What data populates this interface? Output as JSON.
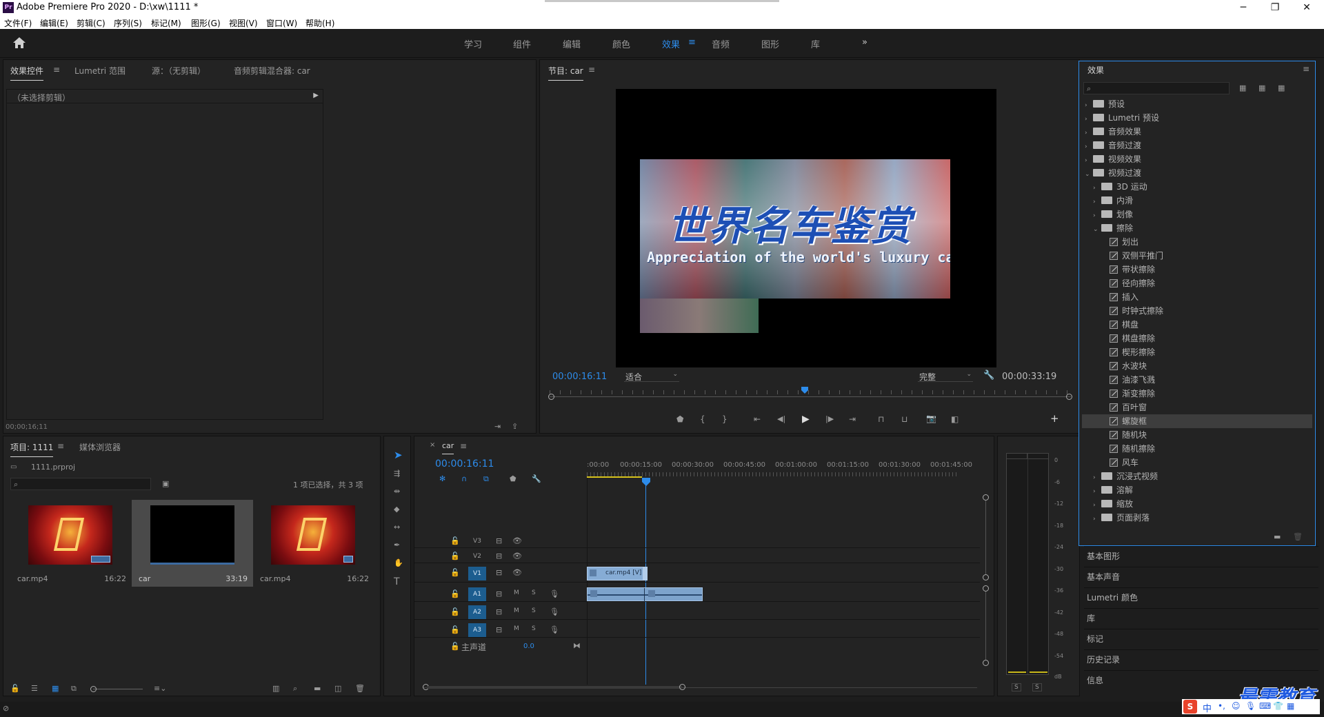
{
  "app": {
    "title": "Adobe Premiere Pro 2020 - D:\\xw\\1111 *",
    "logo": "Pr",
    "menu": [
      "文件(F)",
      "编辑(E)",
      "剪辑(C)",
      "序列(S)",
      "标记(M)",
      "图形(G)",
      "视图(V)",
      "窗口(W)",
      "帮助(H)"
    ]
  },
  "workspaces": {
    "items": [
      "学习",
      "组件",
      "编辑",
      "颜色",
      "效果",
      "音频",
      "图形",
      "库"
    ],
    "active": "效果",
    "active_menu": "≡",
    "more": "»"
  },
  "source_panel": {
    "tabs": [
      "效果控件",
      "Lumetri 范围",
      "源：（无剪辑）",
      "音频剪辑混合器: car"
    ],
    "active_tab_menu": "≡",
    "no_clip": "（未选择剪辑）",
    "timecode": "00;00;16;11"
  },
  "program": {
    "tab": "节目: car",
    "menu": "≡",
    "title_text": "世界名车鉴赏",
    "subtitle_text": "Appreciation of the world's luxury ca",
    "timecode": "00:00:16:11",
    "fit": "适合",
    "quality": "完整",
    "duration": "00:00:33:19",
    "playhead_fraction": 0.49
  },
  "project": {
    "tabs": [
      "项目: 1111",
      "媒体浏览器"
    ],
    "menu": "≡",
    "file": "1111.prproj",
    "selection": "1 项已选择，共 3 项",
    "items": [
      {
        "name": "car.mp4",
        "duration": "16:22"
      },
      {
        "name": "car",
        "duration": "33:19"
      },
      {
        "name": "car.mp4",
        "duration": "16:22"
      }
    ]
  },
  "timeline": {
    "close": "×",
    "sequence": "car",
    "menu": "≡",
    "timecode": "00:00:16:11",
    "ruler": [
      ":00:00",
      "00:00:15:00",
      "00:00:30:00",
      "00:00:45:00",
      "00:01:00:00",
      "00:01:15:00",
      "00:01:30:00",
      "00:01:45:00"
    ],
    "video_tracks": [
      "V3",
      "V2",
      "V1"
    ],
    "audio_tracks": [
      "A1",
      "A2",
      "A3"
    ],
    "master": "主声道",
    "master_value": "0.0",
    "clip_v1": "car.mp4 [V]",
    "m": "M",
    "s": "S"
  },
  "meter": {
    "ticks": [
      "0",
      "-6",
      "-12",
      "-18",
      "-24",
      "-30",
      "-36",
      "-42",
      "-48",
      "-54",
      "dB"
    ],
    "solo_left": "S",
    "solo_right": "S"
  },
  "effects": {
    "title": "效果",
    "menu": "≡",
    "tree": [
      {
        "label": "预设",
        "level": 0,
        "type": "folder",
        "open": false
      },
      {
        "label": "Lumetri 预设",
        "level": 0,
        "type": "folder",
        "open": false
      },
      {
        "label": "音频效果",
        "level": 0,
        "type": "folder",
        "open": false
      },
      {
        "label": "音频过渡",
        "level": 0,
        "type": "folder",
        "open": false
      },
      {
        "label": "视频效果",
        "level": 0,
        "type": "folder",
        "open": false
      },
      {
        "label": "视频过渡",
        "level": 0,
        "type": "folder",
        "open": true
      },
      {
        "label": "3D 运动",
        "level": 1,
        "type": "folder",
        "open": false
      },
      {
        "label": "内滑",
        "level": 1,
        "type": "folder",
        "open": false
      },
      {
        "label": "划像",
        "level": 1,
        "type": "folder",
        "open": false
      },
      {
        "label": "擦除",
        "level": 1,
        "type": "folder",
        "open": true
      },
      {
        "label": "划出",
        "level": 2,
        "type": "effect"
      },
      {
        "label": "双侧平推门",
        "level": 2,
        "type": "effect"
      },
      {
        "label": "带状擦除",
        "level": 2,
        "type": "effect"
      },
      {
        "label": "径向擦除",
        "level": 2,
        "type": "effect"
      },
      {
        "label": "插入",
        "level": 2,
        "type": "effect"
      },
      {
        "label": "时钟式擦除",
        "level": 2,
        "type": "effect"
      },
      {
        "label": "棋盘",
        "level": 2,
        "type": "effect"
      },
      {
        "label": "棋盘擦除",
        "level": 2,
        "type": "effect"
      },
      {
        "label": "楔形擦除",
        "level": 2,
        "type": "effect"
      },
      {
        "label": "水波块",
        "level": 2,
        "type": "effect"
      },
      {
        "label": "油漆飞溅",
        "level": 2,
        "type": "effect"
      },
      {
        "label": "渐变擦除",
        "level": 2,
        "type": "effect"
      },
      {
        "label": "百叶窗",
        "level": 2,
        "type": "effect"
      },
      {
        "label": "螺旋框",
        "level": 2,
        "type": "effect",
        "selected": true
      },
      {
        "label": "随机块",
        "level": 2,
        "type": "effect"
      },
      {
        "label": "随机擦除",
        "level": 2,
        "type": "effect"
      },
      {
        "label": "风车",
        "level": 2,
        "type": "effect"
      },
      {
        "label": "沉浸式视频",
        "level": 1,
        "type": "folder",
        "open": false
      },
      {
        "label": "溶解",
        "level": 1,
        "type": "folder",
        "open": false
      },
      {
        "label": "缩放",
        "level": 1,
        "type": "folder",
        "open": false
      },
      {
        "label": "页面剥落",
        "level": 1,
        "type": "folder",
        "open": false
      }
    ]
  },
  "side_panels": [
    "基本图形",
    "基本声音",
    "Lumetri 颜色",
    "库",
    "标记",
    "历史记录",
    "信息"
  ],
  "watermark": "最需教育",
  "ime": {
    "s": "S",
    "text": "中"
  },
  "colors": {
    "accent": "#2d8ceb",
    "panel": "#232323",
    "bg": "#1d1d1d",
    "selected_track": "#1c5d8f",
    "clip_video": "#86acd5",
    "clip_audio": "#7da3cc"
  }
}
